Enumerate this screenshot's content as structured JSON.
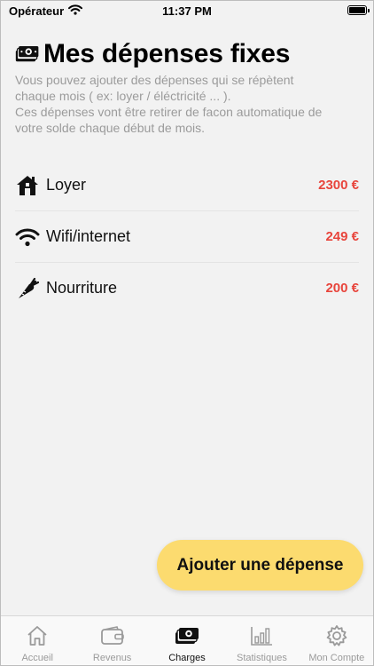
{
  "status_bar": {
    "carrier": "Opérateur",
    "time": "11:37 PM",
    "icons": [
      "wifi-icon",
      "battery-icon"
    ]
  },
  "header": {
    "icon": "money-icon",
    "title": "Mes dépenses fixes",
    "description_lines": [
      "Vous pouvez ajouter des dépenses qui se répètent",
      "chaque mois ( ex: loyer / éléctricité ... ).",
      "Ces dépenses vont être retirer de facon automatique de",
      "votre solde chaque début de mois."
    ]
  },
  "expenses": [
    {
      "icon": "home-icon",
      "label": "Loyer",
      "amount": "2300 €"
    },
    {
      "icon": "wifi-icon",
      "label": "Wifi/internet",
      "amount": "249 €"
    },
    {
      "icon": "carrot-icon",
      "label": "Nourriture",
      "amount": "200 €"
    }
  ],
  "add_button_label": "Ajouter une dépense",
  "tabs": [
    {
      "icon": "home-icon",
      "label": "Accueil",
      "active": false
    },
    {
      "icon": "wallet-icon",
      "label": "Revenus",
      "active": false
    },
    {
      "icon": "money-icon",
      "label": "Charges",
      "active": true
    },
    {
      "icon": "bar-chart-icon",
      "label": "Statistiques",
      "active": false
    },
    {
      "icon": "gear-icon",
      "label": "Mon Compte",
      "active": false
    }
  ],
  "colors": {
    "background": "#f2f2f2",
    "amount": "#e8453c",
    "accent_button": "#fcdb6f",
    "muted_text": "#9b9b9b"
  }
}
